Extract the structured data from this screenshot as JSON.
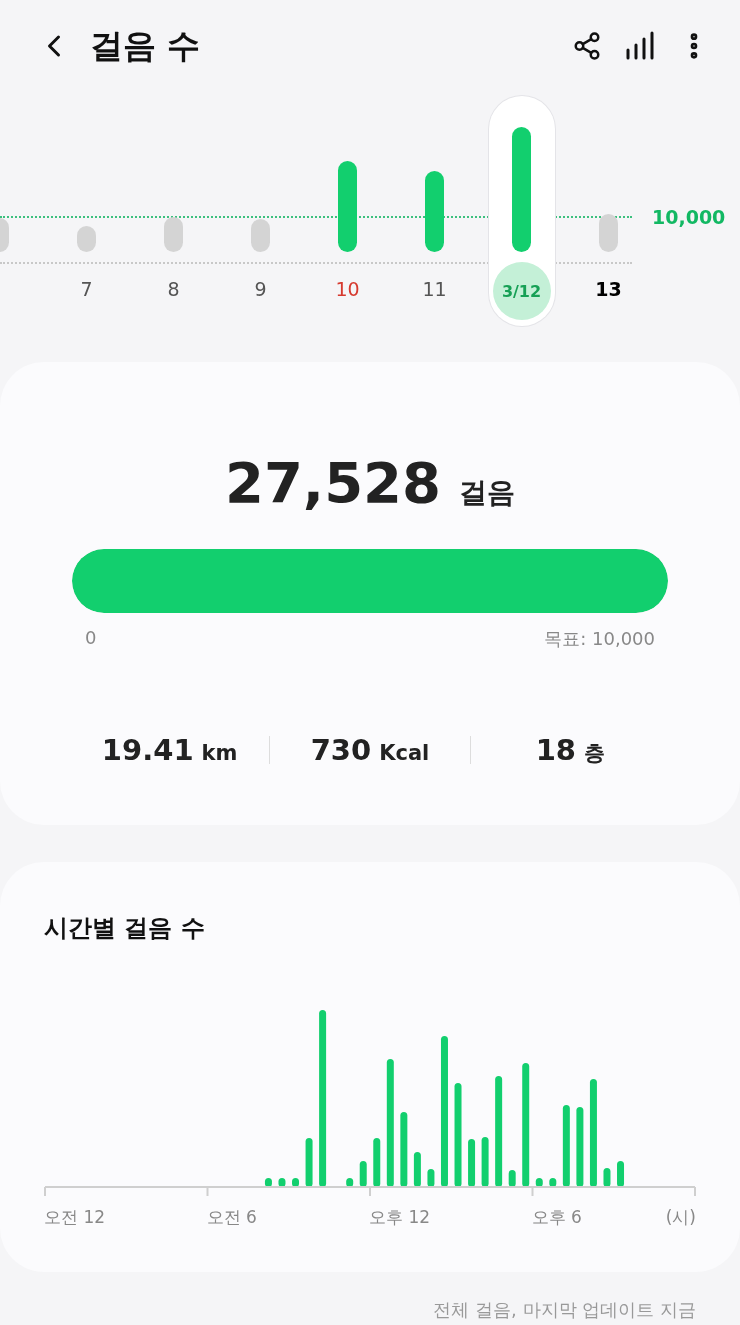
{
  "header": {
    "title": "걸음 수"
  },
  "daily_chart": {
    "goal_label": "10,000",
    "days": [
      {
        "goal_met": false,
        "selected": false
      },
      {
        "label": "7",
        "goal_met": false,
        "selected": false,
        "kind": "normal"
      },
      {
        "label": "8",
        "goal_met": false,
        "selected": false,
        "kind": "normal"
      },
      {
        "label": "9",
        "goal_met": false,
        "selected": false,
        "kind": "normal"
      },
      {
        "label": "10",
        "goal_met": true,
        "selected": false,
        "kind": "holiday"
      },
      {
        "label": "11",
        "goal_met": true,
        "selected": false,
        "kind": "normal"
      },
      {
        "label": "3/12",
        "goal_met": true,
        "selected": true,
        "kind": "normal"
      },
      {
        "label": "13",
        "goal_met": false,
        "selected": false,
        "kind": "emphasis"
      }
    ]
  },
  "summary": {
    "steps": "27,528",
    "unit": "걸음",
    "progress": {
      "level": 1.0,
      "start_label": "0",
      "goal_label": "목표: 10,000"
    },
    "stats": [
      {
        "value": "19.41",
        "unit": "km"
      },
      {
        "value": "730",
        "unit": "Kcal"
      },
      {
        "value": "18",
        "unit": "층"
      }
    ]
  },
  "hourly": {
    "title": "시간별 걸음 수",
    "axis_labels": [
      "오전 12",
      "오전 6",
      "오후 12",
      "오후 6",
      "(시)"
    ]
  },
  "footer": "전체 걸음, 마지막 업데이트 지금"
}
